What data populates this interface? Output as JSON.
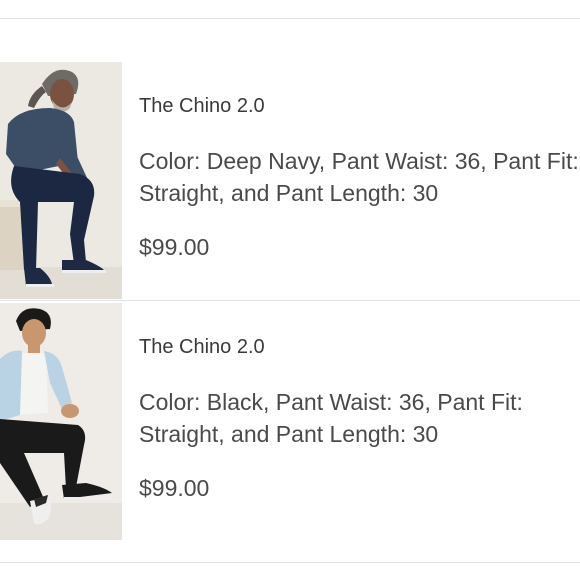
{
  "cart": {
    "items": [
      {
        "name": "The Chino 2.0",
        "variant": "Color: Deep Navy, Pant Waist: 36, Pant Fit: Straight, and Pant Length: 30",
        "price": "$99.00",
        "image_icon": "model-photo-navy-chino"
      },
      {
        "name": "The Chino 2.0",
        "variant": "Color: Black, Pant Waist: 36, Pant Fit: Straight, and Pant Length: 30",
        "price": "$99.00",
        "image_icon": "model-photo-black-chino"
      }
    ]
  },
  "colors": {
    "divider": "#e3e3e3",
    "text": "#4a4a4a",
    "background": "#ffffff"
  }
}
